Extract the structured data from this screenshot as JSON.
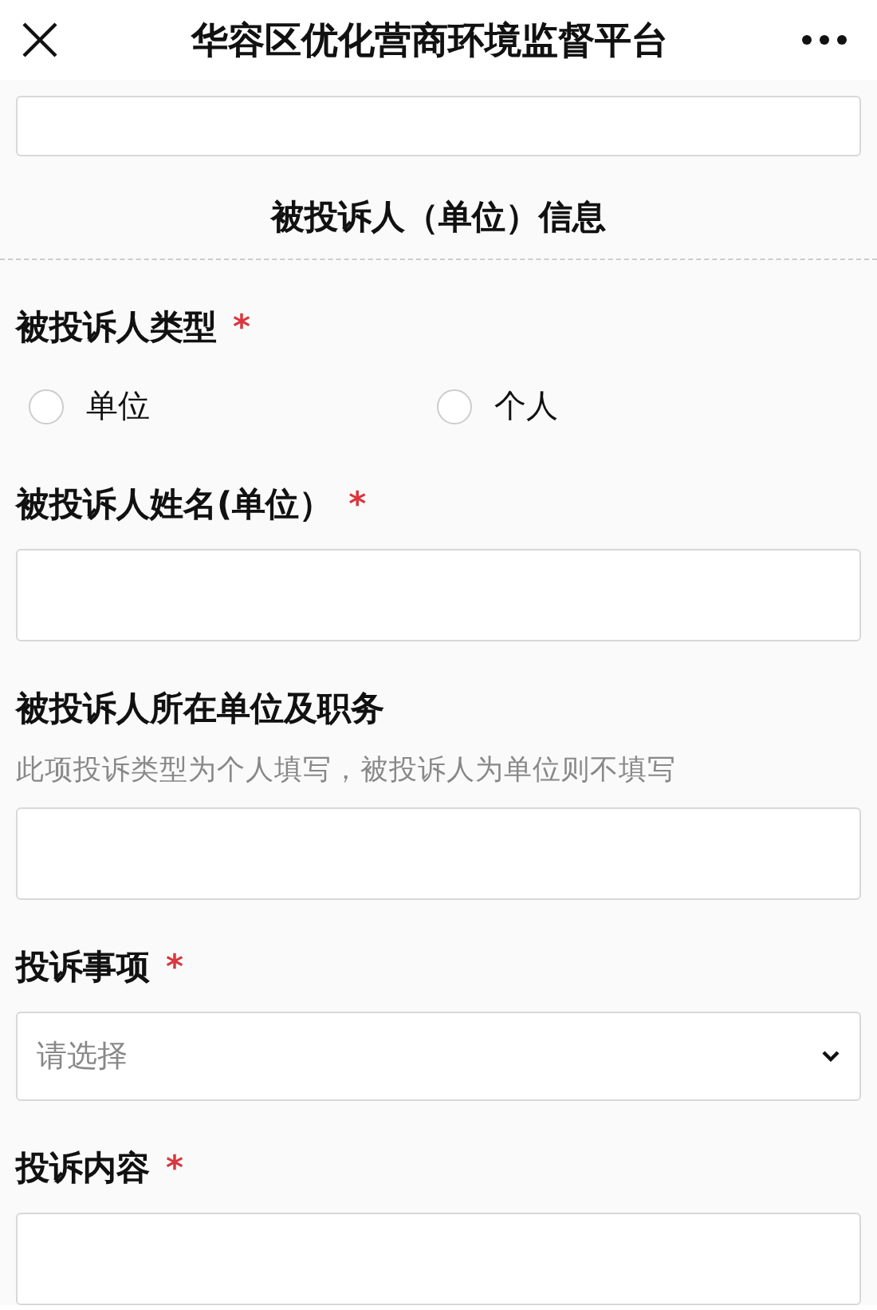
{
  "header": {
    "title": "华容区优化营商环境监督平台"
  },
  "items": [
    {
      "kind": "input"
    },
    {
      "kind": "section",
      "title": "被投诉人（单位）信息"
    },
    {
      "kind": "field",
      "label": "被投诉人类型",
      "required_mark": "*",
      "control": {
        "kind": "radio",
        "options": [
          {
            "label": "单位",
            "selected": false
          },
          {
            "label": "个人",
            "selected": false
          }
        ]
      }
    },
    {
      "kind": "field",
      "label": "被投诉人姓名(单位）",
      "required_mark": "*",
      "control": {
        "kind": "input"
      }
    },
    {
      "kind": "field",
      "label": "被投诉人所在单位及职务",
      "hint": "此项投诉类型为个人填写，被投诉人为单位则不填写",
      "control": {
        "kind": "input"
      }
    },
    {
      "kind": "field",
      "label": "投诉事项",
      "required_mark": "*",
      "control": {
        "kind": "select",
        "placeholder": "请选择"
      }
    },
    {
      "kind": "field",
      "label": "投诉内容",
      "required_mark": "*",
      "control": {
        "kind": "input"
      }
    }
  ]
}
